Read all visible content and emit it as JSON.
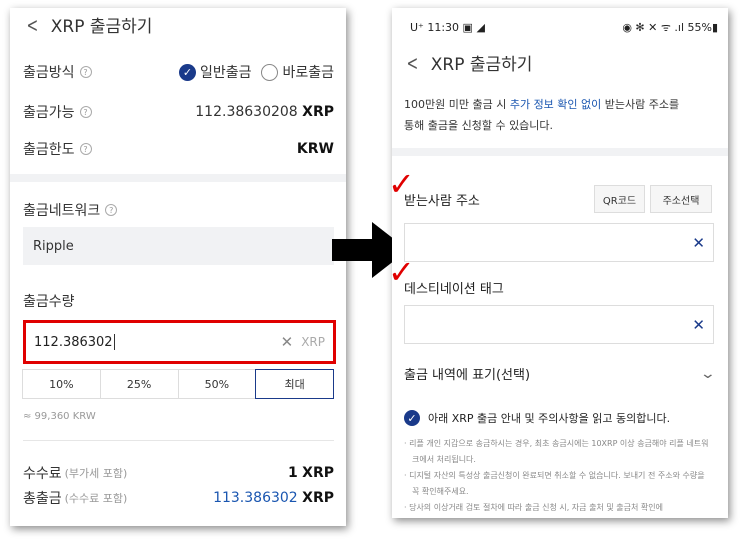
{
  "left": {
    "title": "XRP 출금하기",
    "method": {
      "label": "출금방식",
      "opt1": "일반출금",
      "opt2": "바로출금"
    },
    "available": {
      "label": "출금가능",
      "amount": "112.38630208",
      "unit": "XRP"
    },
    "limit": {
      "label": "출금한도",
      "unit": "KRW"
    },
    "network": {
      "label": "출금네트워크",
      "value": "Ripple"
    },
    "amount": {
      "label": "출금수량",
      "value": "112.386302",
      "unit": "XRP"
    },
    "percents": [
      "10%",
      "25%",
      "50%",
      "최대"
    ],
    "krw": "≈ 99,360 KRW",
    "fee": {
      "label": "수수료",
      "sub": "(부가세 포함)",
      "amount": "1",
      "unit": "XRP"
    },
    "total": {
      "label": "총출금",
      "sub": "(수수료 포함)",
      "amount": "113.386302",
      "unit": "XRP"
    }
  },
  "right": {
    "status_left": "U⁺ 11:30 ▣ ◢",
    "status_right": "◉ ✻ ✕ ᯤ .ıl 55%▮",
    "title": "XRP 출금하기",
    "info_pre": "100만원 미만 출금 시 ",
    "info_link": "추가 정보 확인 없이",
    "info_post": " 받는사람 주소를",
    "info_line2": "통해 출금을 신청할 수 있습니다.",
    "address_label": "받는사람 주소",
    "qr_button": "QR코드",
    "select_button": "주소선택",
    "tag_label": "데스티네이션 태그",
    "memo_label": "출금 내역에 표기(선택)",
    "agree_text": "아래 XRP 출금 안내 및 주의사항을 읽고 동의합니다.",
    "notes": [
      "· 리플 개인 지갑으로 송금하시는 경우, 최초 송금시에는 10XRP 이상 송금해야 리플 네트워크에서 처리됩니다.",
      "· 디지털 자산의 특성상 출금신청이 완료되면 취소할 수 없습니다. 보내기 전 주소와 수량을 꼭 확인해주세요.",
      "· 당사의 이상거래 검토 절차에 따라 출금 신청 시, 자금 출처 및 출금처 확인에"
    ]
  },
  "colors": {
    "accent": "#1a3a8a",
    "link": "#1a56b0",
    "highlight": "#e00000"
  }
}
